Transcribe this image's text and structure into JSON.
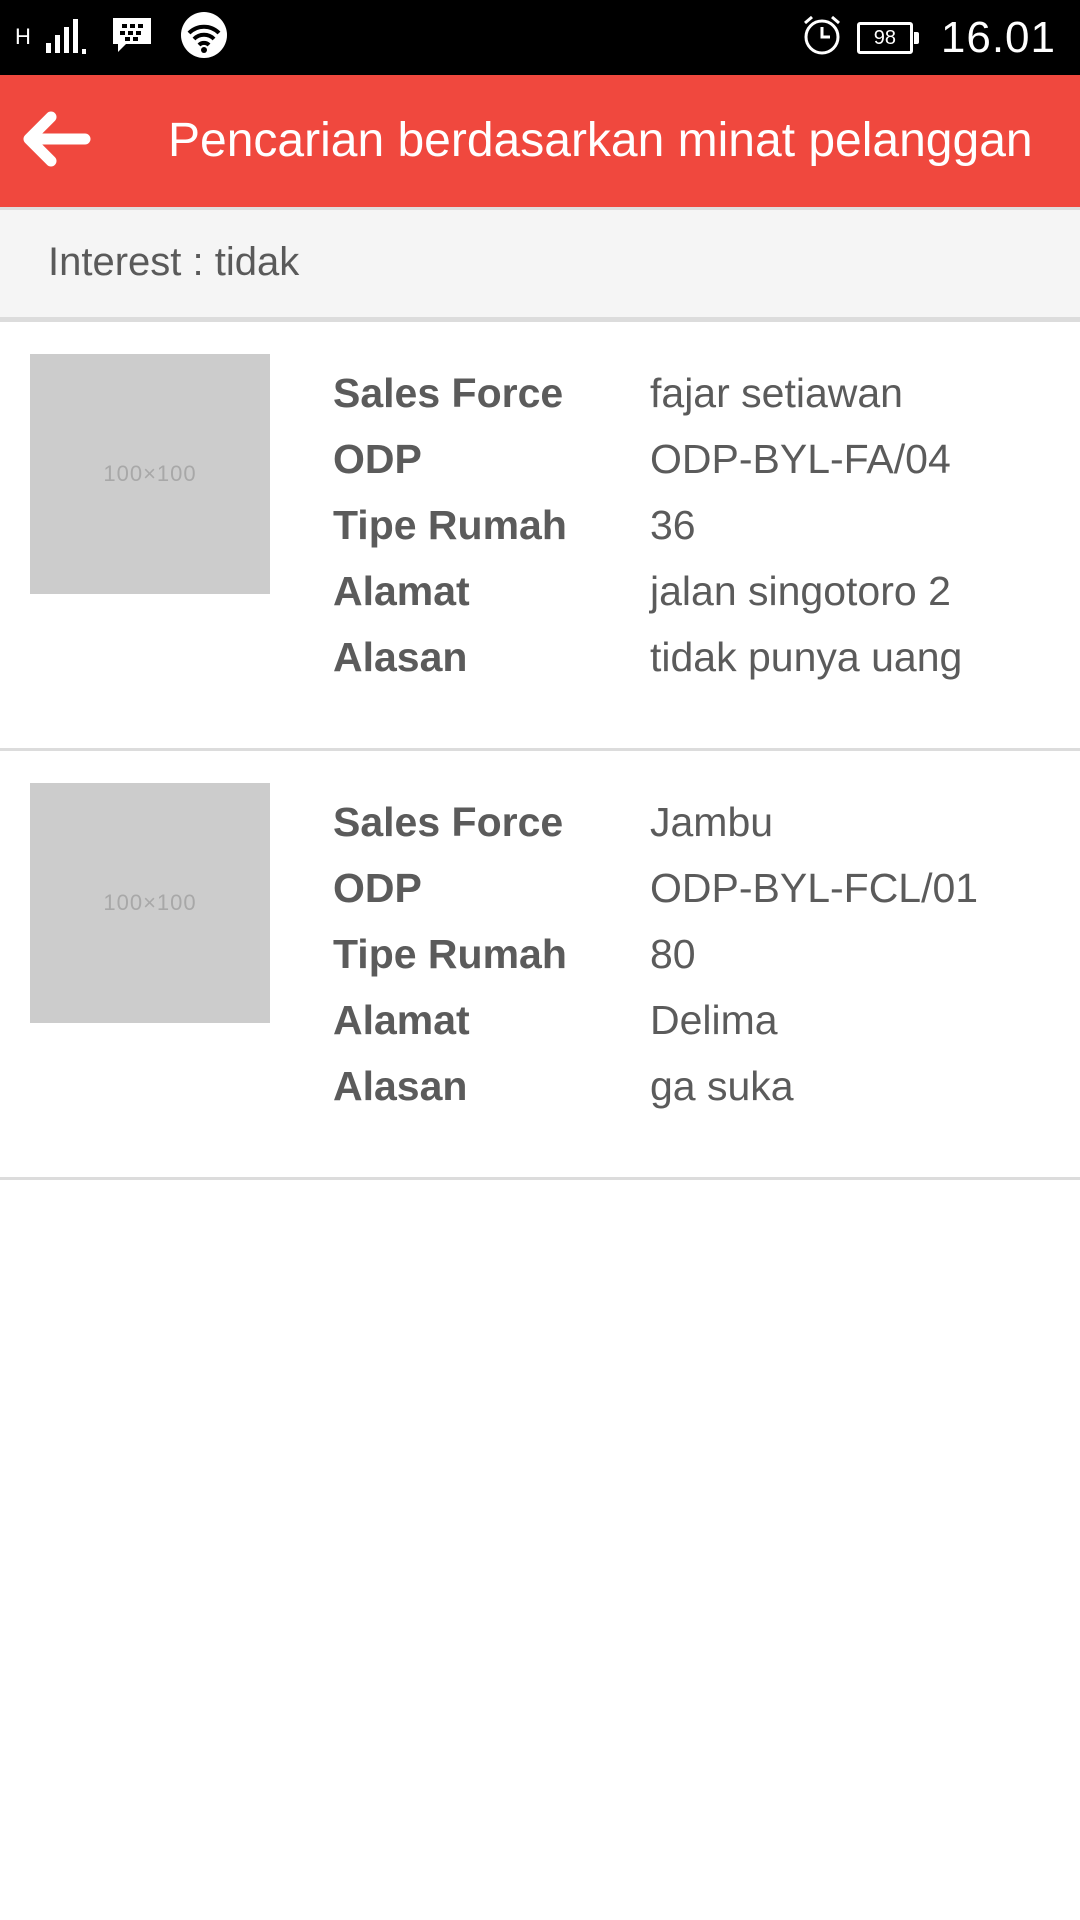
{
  "status_bar": {
    "network_type": "H",
    "battery_level": "98",
    "time": "16.01"
  },
  "app_bar": {
    "title": "Pencarian berdasarkan minat pelanggan",
    "back_icon": "arrow-left-icon"
  },
  "filter": {
    "text": "Interest : tidak"
  },
  "labels": {
    "sales_force": "Sales Force",
    "odp": "ODP",
    "tipe_rumah": "Tipe Rumah",
    "alamat": "Alamat",
    "alasan": "Alasan"
  },
  "items": [
    {
      "thumbnail_text": "100×100",
      "sales_force": "fajar setiawan",
      "odp": "ODP-BYL-FA/04",
      "tipe_rumah": "36",
      "alamat": "jalan singotoro 2",
      "alasan": "tidak punya uang"
    },
    {
      "thumbnail_text": "100×100",
      "sales_force": "Jambu",
      "odp": "ODP-BYL-FCL/01",
      "tipe_rumah": "80",
      "alamat": "Delima",
      "alasan": "ga suka"
    }
  ],
  "colors": {
    "app_bar": "#f0483e",
    "status_bar": "#000000",
    "text": "#5b5b5b",
    "placeholder": "#cccccc"
  }
}
